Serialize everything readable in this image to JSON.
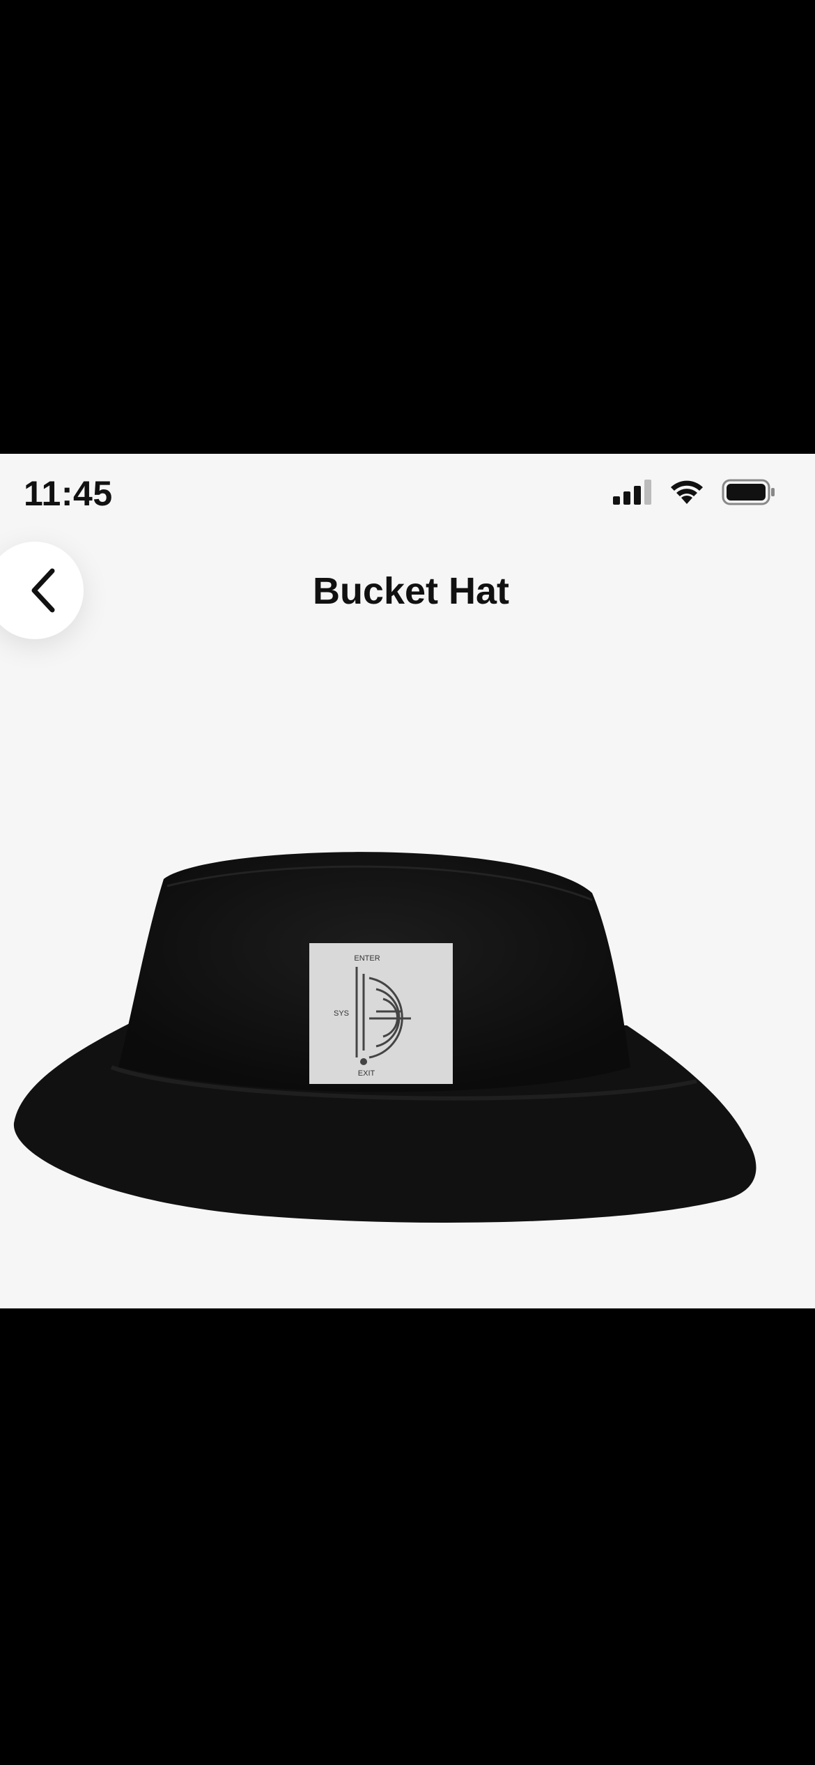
{
  "status_bar": {
    "time": "11:45"
  },
  "nav": {
    "title": "Bucket Hat"
  },
  "icons": {
    "back": "chevron-left-icon",
    "signal": "cellular-signal-icon",
    "wifi": "wifi-icon",
    "battery": "battery-icon"
  },
  "product": {
    "patch_labels": {
      "top": "ENTER",
      "left": "SYS",
      "bottom": "EXIT"
    }
  },
  "colors": {
    "background": "#000000",
    "card": "#f6f6f6",
    "hat": "#141414",
    "patch": "#d9d9d9",
    "text": "#111111"
  }
}
